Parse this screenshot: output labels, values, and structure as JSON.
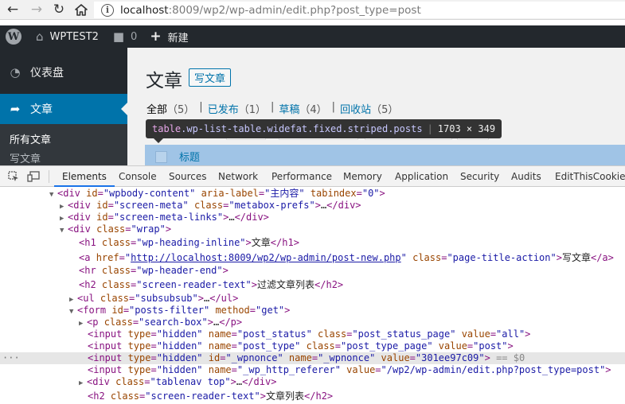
{
  "browser": {
    "back_icon": "back-arrow-icon",
    "forward_icon": "forward-arrow-icon",
    "reload_icon": "reload-icon",
    "home_icon": "home-icon",
    "url_host": "localhost",
    "url_rest": ":8009/wp2/wp-admin/edit.php?post_type=post"
  },
  "adminbar": {
    "site_name": "WPTEST2",
    "comment_count": "0",
    "new_label": "新建"
  },
  "sidebar": {
    "dashboard": "仪表盘",
    "posts": "文章",
    "sub_all": "所有文章",
    "sub_new": "写文章"
  },
  "main": {
    "title": "文章",
    "add_new": "写文章",
    "filters": [
      {
        "label": "全部",
        "count": "（5）"
      },
      {
        "label": "已发布",
        "count": "（1）"
      },
      {
        "label": "草稿",
        "count": "（4）"
      },
      {
        "label": "回收站",
        "count": "（5）"
      }
    ],
    "table_col_title": "标题"
  },
  "tooltip": {
    "tag": "table",
    "classes": ".wp-list-table.widefat.fixed.striped.posts",
    "dims": "1703 × 349"
  },
  "devtools": {
    "tabs": [
      "Elements",
      "Console",
      "Sources",
      "Network",
      "Performance",
      "Memory",
      "Application",
      "Security",
      "Audits",
      "EditThisCookie"
    ],
    "lines": {
      "l1_id": "\"wpbody-content\"",
      "l1_aria": "\"主内容\"",
      "l1_tab": "\"0\"",
      "l2_id": "\"screen-meta\"",
      "l2_cls": "\"metabox-prefs\"",
      "l3_id": "\"screen-meta-links\"",
      "l4_cls": "\"wrap\"",
      "l5_cls": "\"wp-heading-inline\"",
      "l5_text": "文章",
      "l6_href": "http://localhost:8009/wp2/wp-admin/post-new.php",
      "l6_cls": "\"page-title-action\"",
      "l6_text": "写文章",
      "l7_cls": "\"wp-header-end\"",
      "l8_cls": "\"screen-reader-text\"",
      "l8_text": "过滤文章列表",
      "l9_cls": "\"subsubsub\"",
      "l10_id": "\"posts-filter\"",
      "l10_method": "\"get\"",
      "l11_cls": "\"search-box\"",
      "l12_type": "\"hidden\"",
      "l12_name": "\"post_status\"",
      "l12_cls": "\"post_status_page\"",
      "l12_val": "\"all\"",
      "l13_type": "\"hidden\"",
      "l13_name": "\"post_type\"",
      "l13_cls": "\"post_type_page\"",
      "l13_val": "\"post\"",
      "l14_type": "\"hidden\"",
      "l14_id": "\"_wpnonce\"",
      "l14_name": "\"_wpnonce\"",
      "l14_val": "\"301ee97c09\"",
      "l14_ref": "== $0",
      "l15_type": "\"hidden\"",
      "l15_name": "\"_wp_http_referer\"",
      "l15_val": "\"/wp2/wp-admin/edit.php?post_type=post\"",
      "l16_cls": "\"tablenav top\"",
      "l17_cls": "\"screen-reader-text\"",
      "l17_text": "文章列表"
    }
  }
}
